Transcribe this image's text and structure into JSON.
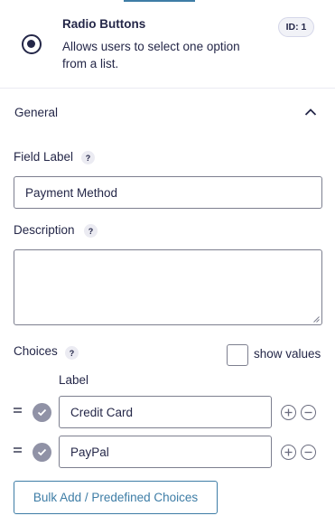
{
  "field": {
    "type_name": "Radio Buttons",
    "type_description": "Allows users to select one option from a list.",
    "id_badge": "ID: 1",
    "type_icon": "radio-icon"
  },
  "section": {
    "title": "General",
    "toggle_icon": "chevron-up-icon"
  },
  "field_label": {
    "label": "Field Label",
    "help": "?",
    "value": "Payment Method"
  },
  "description": {
    "label": "Description",
    "help": "?",
    "value": ""
  },
  "choices": {
    "label": "Choices",
    "help": "?",
    "show_values_label": "show values",
    "show_values_checked": false,
    "column_label": "Label",
    "items": [
      {
        "label": "Credit Card",
        "selected": false
      },
      {
        "label": "PayPal",
        "selected": false
      }
    ]
  },
  "bulk_add_label": "Bulk Add / Predefined Choices",
  "colors": {
    "accent": "#3e7da6",
    "text": "#242748",
    "border": "#7d7f8f"
  }
}
